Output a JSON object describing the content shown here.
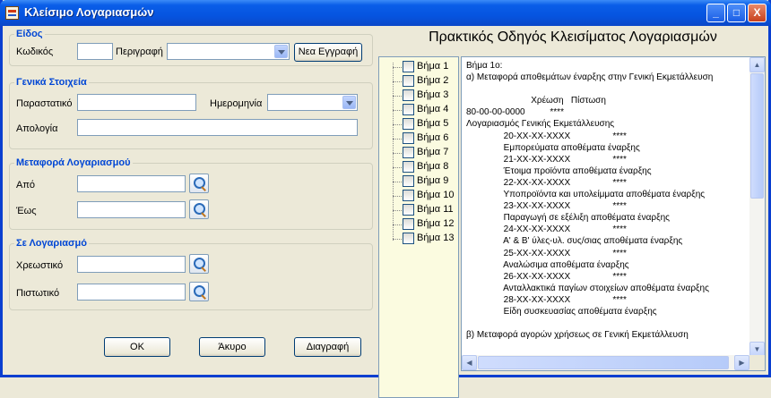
{
  "window": {
    "title": "Κλείσιμο Λογαριασμών",
    "controls": [
      "_",
      "□",
      "X"
    ]
  },
  "eidos": {
    "title": "Είδος",
    "code_label": "Κωδικός",
    "code_value": "",
    "desc_label": "Περιγραφή",
    "desc_value": "",
    "new_button": "Νεα Εγγραφή"
  },
  "general": {
    "title": "Γενικά Στοιχεία",
    "doc_label": "Παραστατικό",
    "doc_value": "",
    "date_label": "Ημερομηνία",
    "date_value": "",
    "reason_label": "Απολογία",
    "reason_value": ""
  },
  "transfer": {
    "title": "Μεταφορά Λογαριασμού",
    "from_label": "Από",
    "from_value": "",
    "to_label": "Έως",
    "to_value": ""
  },
  "target": {
    "title": "Σε Λογαριασμό",
    "debit_label": "Χρεωστικό",
    "debit_value": "",
    "credit_label": "Πιστωτικό",
    "credit_value": ""
  },
  "buttons": {
    "ok": "ΟΚ",
    "cancel": "Άκυρο",
    "delete": "Διαγραφή"
  },
  "guide": {
    "title": "Πρακτικός Οδηγός Κλεισίματος Λογαριασμών",
    "steps": [
      "Βήμα 1",
      "Βήμα 2",
      "Βήμα 3",
      "Βήμα 4",
      "Βήμα 5",
      "Βήμα 6",
      "Βήμα 7",
      "Βήμα 8",
      "Βήμα 9",
      "Βήμα 10",
      "Βήμα 11",
      "Βήμα 12",
      "Βήμα 13"
    ],
    "content": "Βήμα 1ο:\nα) Μεταφορά αποθεμάτων έναρξης στην Γενική Εκμετάλλευση\n\n                          Χρέωση   Πίστωση\n80-00-00-0000          ****\nΛογαριασμός Γενικής Εκμετάλλευσης\n               20-ΧΧ-ΧΧ-ΧΧΧΧ                 ****\n               Εμπορεύματα αποθέματα έναρξης\n               21-ΧΧ-ΧΧ-ΧΧΧΧ                 ****\n               Έτοιμα προϊόντα αποθέματα έναρξης\n               22-ΧΧ-ΧΧ-ΧΧΧΧ                 ****\n               Υποπροϊόντα και υπολείμματα αποθέματα έναρξης\n               23-ΧΧ-ΧΧ-ΧΧΧΧ                 ****\n               Παραγωγή σε εξέλιξη αποθέματα έναρξης\n               24-ΧΧ-ΧΧ-ΧΧΧΧ                 ****\n               Α' & Β' ύλες-υλ. συς/σιας αποθέματα έναρξης\n               25-ΧΧ-ΧΧ-ΧΧΧΧ                 ****\n               Αναλώσιμα αποθέματα έναρξης\n               26-ΧΧ-ΧΧ-ΧΧΧΧ                 ****\n               Ανταλλακτικά παγίων στοιχείων αποθέματα έναρξης\n               28-ΧΧ-ΧΧ-ΧΧΧΧ                 ****\n               Είδη συσκευασίας αποθέματα έναρξης\n\nβ) Μεταφορά αγορών χρήσεως σε Γενική Εκμετάλλευση"
  }
}
